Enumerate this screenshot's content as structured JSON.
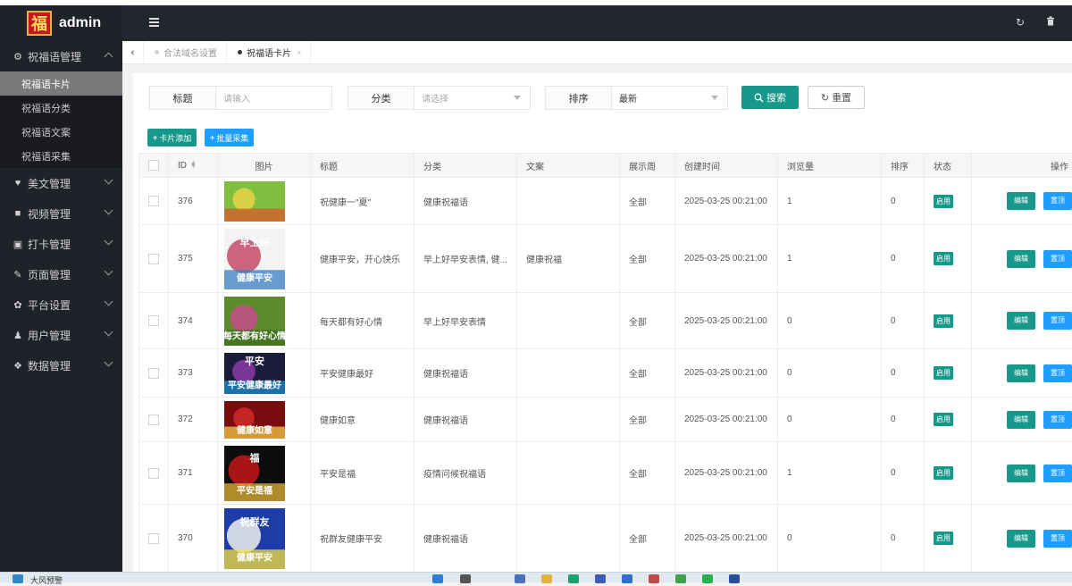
{
  "app": {
    "logo_glyph": "福",
    "name": "admin"
  },
  "sidebar": {
    "groups": [
      {
        "label": "祝福语管理",
        "icon": "gear-icon",
        "expanded": true,
        "items": [
          {
            "label": "祝福语卡片",
            "active": true
          },
          {
            "label": "祝福语分类",
            "active": false
          },
          {
            "label": "祝福语文案",
            "active": false
          },
          {
            "label": "祝福语采集",
            "active": false
          }
        ]
      },
      {
        "label": "美文管理",
        "icon": "heart-icon"
      },
      {
        "label": "视频管理",
        "icon": "video-icon"
      },
      {
        "label": "打卡管理",
        "icon": "calendar-icon"
      },
      {
        "label": "页面管理",
        "icon": "wrench-icon"
      },
      {
        "label": "平台设置",
        "icon": "gear-icon"
      },
      {
        "label": "用户管理",
        "icon": "users-icon"
      },
      {
        "label": "数据管理",
        "icon": "cubes-icon"
      }
    ]
  },
  "header": {
    "icons": [
      "menu-icon",
      "refresh-icon",
      "trash-icon"
    ]
  },
  "tabs": [
    {
      "label": "合法域名设置",
      "active": false
    },
    {
      "label": "祝福语卡片",
      "active": true,
      "close": "×"
    }
  ],
  "filters": {
    "title": {
      "label": "标题",
      "placeholder": "请输入"
    },
    "category": {
      "label": "分类",
      "placeholder": "请选择"
    },
    "sort": {
      "label": "排序",
      "value": "最新"
    }
  },
  "buttons": {
    "search": "搜索",
    "reset": "重置",
    "add": "卡片添加",
    "batch": "批量采集"
  },
  "table": {
    "headers": [
      "ID",
      "图片",
      "标题",
      "分类",
      "文案",
      "展示周",
      "创建时间",
      "浏览量",
      "排序",
      "状态",
      "操作"
    ],
    "rows": [
      {
        "id": "376",
        "title": "祝健康一\"夏\"",
        "category": "健康祝福语",
        "copy": "",
        "display": "全部",
        "created": "2025-03-25 00:21:00",
        "views": "1",
        "sort": "0",
        "status": "启用"
      },
      {
        "id": "375",
        "title": "健康平安，开心快乐",
        "category": "早上好早安表情, 健...",
        "copy": "健康祝福",
        "display": "全部",
        "created": "2025-03-25 00:21:00",
        "views": "1",
        "sort": "0",
        "status": "启用"
      },
      {
        "id": "374",
        "title": "每天都有好心情",
        "category": "早上好早安表情",
        "copy": "",
        "display": "全部",
        "created": "2025-03-25 00:21:00",
        "views": "0",
        "sort": "0",
        "status": "启用"
      },
      {
        "id": "373",
        "title": "平安健康最好",
        "category": "健康祝福语",
        "copy": "",
        "display": "全部",
        "created": "2025-03-25 00:21:00",
        "views": "0",
        "sort": "0",
        "status": "启用"
      },
      {
        "id": "372",
        "title": "健康如意",
        "category": "健康祝福语",
        "copy": "",
        "display": "全部",
        "created": "2025-03-25 00:21:00",
        "views": "0",
        "sort": "0",
        "status": "启用"
      },
      {
        "id": "371",
        "title": "平安是福",
        "category": "疫情问候祝福语",
        "copy": "",
        "display": "全部",
        "created": "2025-03-25 00:21:00",
        "views": "1",
        "sort": "0",
        "status": "启用"
      },
      {
        "id": "370",
        "title": "祝群友健康平安",
        "category": "健康祝福语",
        "copy": "",
        "display": "全部",
        "created": "2025-03-25 00:21:00",
        "views": "0",
        "sort": "0",
        "status": "启用"
      }
    ],
    "row_actions": {
      "edit": "编辑",
      "top": "置顶"
    },
    "thumbnails": [
      {
        "lines": [
          "",
          ""
        ],
        "colors": [
          "#7fbf3f",
          "#e8d34a",
          "#d95a2b"
        ]
      },
      {
        "lines": [
          "早上好",
          "健康平安"
        ],
        "colors": [
          "#f3f3f3",
          "#c44a6a",
          "#3a7fc4"
        ]
      },
      {
        "lines": [
          "",
          "每天都有好心情"
        ],
        "colors": [
          "#5e8a2e",
          "#c74c8a",
          "#3f6d1f"
        ]
      },
      {
        "lines": [
          "平安",
          "平安健康最好"
        ],
        "colors": [
          "#1b1b3a",
          "#8a3aa8",
          "#1f8fd0"
        ]
      },
      {
        "lines": [
          "",
          "健康如意"
        ],
        "colors": [
          "#7a0c10",
          "#d42a2a",
          "#f3c94a"
        ]
      },
      {
        "lines": [
          "福",
          "平安是福"
        ],
        "colors": [
          "#0d0d0d",
          "#c4181c",
          "#e5b634"
        ]
      },
      {
        "lines": [
          "祝群友",
          "健康平安"
        ],
        "colors": [
          "#1d3ca8",
          "#f0f0f0",
          "#f5e23a"
        ]
      }
    ]
  },
  "taskbar": {
    "label": "大风预警"
  },
  "colors": {
    "primary": "#16998a",
    "info": "#1e9fff",
    "sidebar_bg": "#20222a",
    "header_bg": "#23262e"
  }
}
